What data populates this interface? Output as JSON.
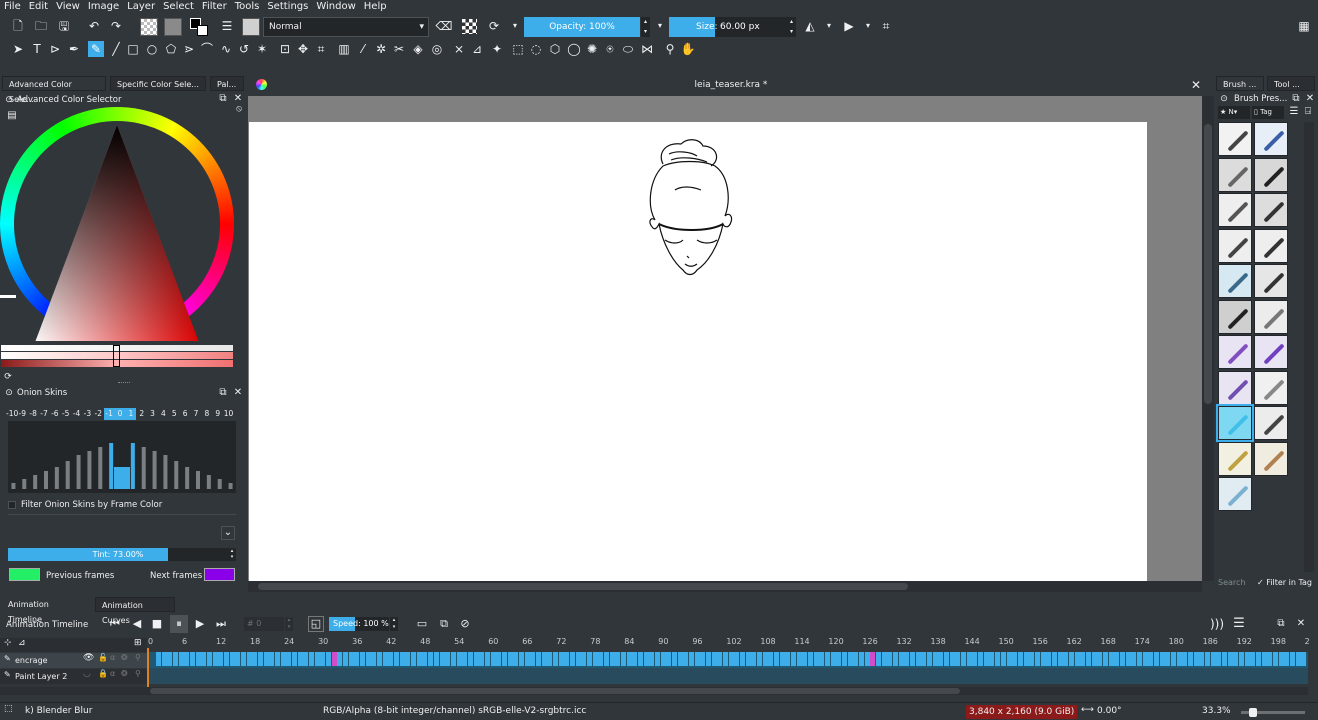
{
  "menu": [
    "File",
    "Edit",
    "View",
    "Image",
    "Layer",
    "Select",
    "Filter",
    "Tools",
    "Settings",
    "Window",
    "Help"
  ],
  "toolbar": {
    "blend_mode": "Normal",
    "opacity": "Opacity: 100%",
    "size_label": "Size:",
    "size_value": "60.00 px"
  },
  "tool_icons": [
    "select-icon",
    "text-icon",
    "edit-shapes-icon",
    "calligraphy-icon",
    "freehand-brush-icon",
    "line-icon",
    "rectangle-icon",
    "ellipse-icon",
    "polygon-icon",
    "polyline-icon",
    "bezier-icon",
    "freehand-path-icon",
    "dynamic-brush-icon",
    "multibrush-icon",
    "transform-icon",
    "move-icon",
    "crop-icon",
    "gradient-icon",
    "color-picker-icon",
    "colorize-mask-icon",
    "smart-patch-icon",
    "fill-icon",
    "assistant-icon",
    "measure-icon",
    "reference-images-icon",
    "rect-select-icon",
    "ellipse-select-icon",
    "polygon-select-icon",
    "freehand-select-icon",
    "contiguous-select-icon",
    "similar-select-icon",
    "bezier-select-icon",
    "magnetic-select-icon",
    "zoom-icon",
    "pan-icon"
  ],
  "left_tabs": [
    "Advanced Color Sele...",
    "Specific Color Sele...",
    "Pal..."
  ],
  "color_selector": {
    "title": "Advanced Color Selector"
  },
  "onion": {
    "title": "Onion Skins",
    "numbers": [
      "-10",
      "-9",
      "-8",
      "-7",
      "-6",
      "-5",
      "-4",
      "-3",
      "-2",
      "-1",
      "0",
      "1",
      "2",
      "3",
      "4",
      "5",
      "6",
      "7",
      "8",
      "9",
      "10"
    ],
    "filter_label": "Filter Onion Skins by Frame Color",
    "tint": "Tint: 73.00%",
    "prev_label": "Previous frames",
    "next_label": "Next frames",
    "prev_color": "#22ee66",
    "next_color": "#8a00e8"
  },
  "document": {
    "tab_title": "leia_teaser.kra *"
  },
  "right_tabs": [
    "Brush ...",
    "Tool ..."
  ],
  "brush_presets": {
    "title": "Brush Pres...",
    "tag_label": "Tag",
    "filter_label": "Filter in Tag",
    "search_placeholder": "Search"
  },
  "bottom_tabs": [
    "Animation Timeline",
    "Animation Curves"
  ],
  "timeline": {
    "title": "Animation Timeline",
    "frame_field": "0",
    "speed": "Speed: 100 %",
    "ruler": [
      "0",
      "6",
      "12",
      "18",
      "24",
      "30",
      "36",
      "42",
      "48",
      "54",
      "60",
      "66",
      "72",
      "78",
      "84",
      "90",
      "96",
      "102",
      "108",
      "114",
      "120",
      "126",
      "132",
      "138",
      "144",
      "150",
      "156",
      "162",
      "168",
      "174",
      "180",
      "186",
      "192",
      "198",
      "2"
    ],
    "layers": [
      {
        "name": "encrage"
      },
      {
        "name": "Paint Layer 2"
      }
    ]
  },
  "status": {
    "brush": "k) Blender Blur",
    "color_space": "RGB/Alpha (8-bit integer/channel)  sRGB-elle-V2-srgbtrc.icc",
    "dimensions": "3,840 x 2,160 (9.0 GiB)",
    "rotation": "0.00°",
    "zoom": "33.3%"
  },
  "colors": {
    "accent": "#3daee9",
    "bg": "#31363b",
    "canvas_bg": "#808080",
    "keyframe": "#d14cc8",
    "status_warn": "#8b1a1a"
  }
}
